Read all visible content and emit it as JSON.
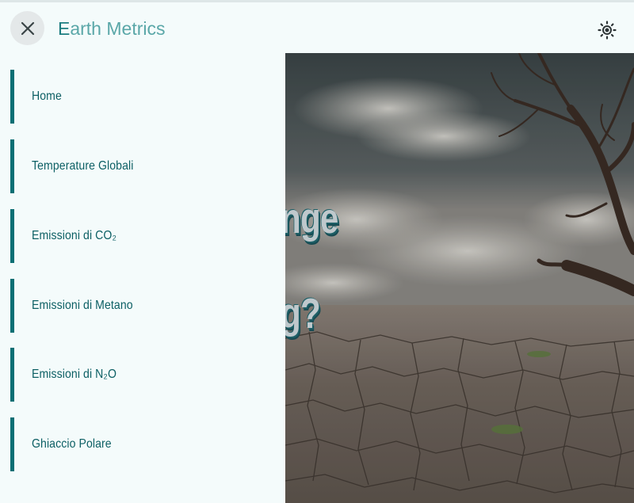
{
  "app": {
    "brand_first": "E",
    "brand_rest": "arth Metrics"
  },
  "header": {
    "close_icon": "close-icon",
    "theme_icon": "sun-icon"
  },
  "sidebar": {
    "items": [
      {
        "label": "Home"
      },
      {
        "label": "Temperature Globali"
      },
      {
        "label": "Emissioni di CO₂"
      },
      {
        "label": "Emissioni di Metano"
      },
      {
        "label": "Emissioni di N₂O"
      },
      {
        "label": "Ghiaccio Polare"
      }
    ]
  },
  "hero": {
    "text_line1": "nge",
    "text_line2": "g?"
  },
  "colors": {
    "accent": "#0b6f74",
    "background": "#f4fbfb",
    "brand_light": "#5aa7a8"
  }
}
